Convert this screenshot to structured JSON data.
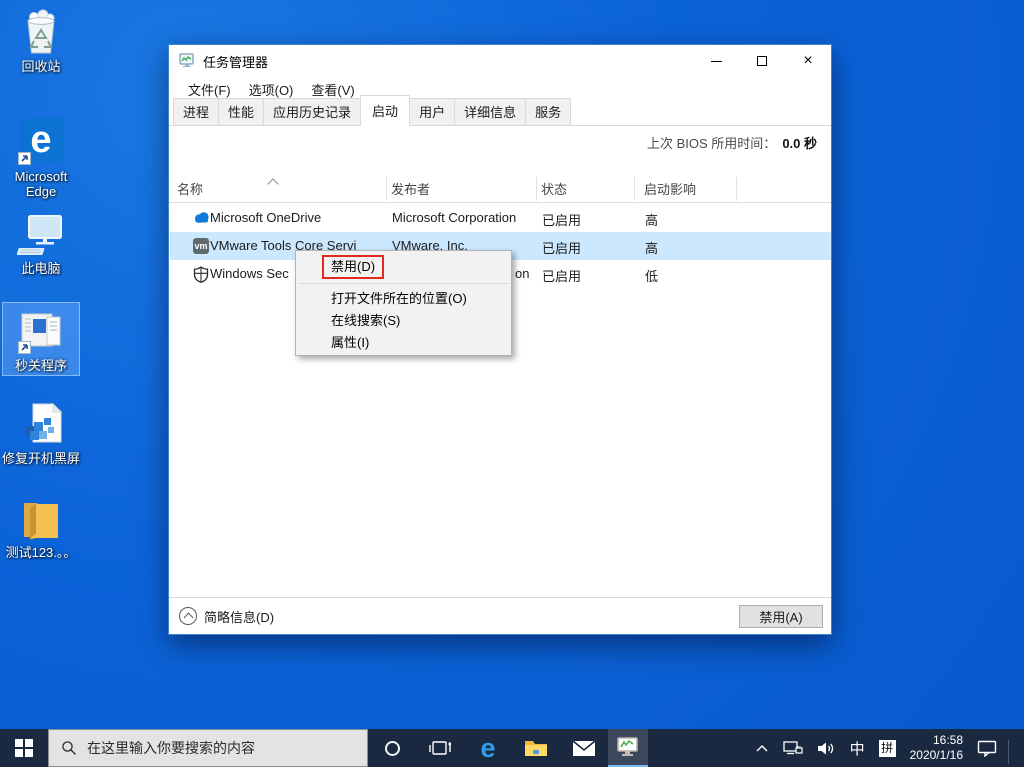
{
  "colors": {
    "desktop_blue": "#0b63d8",
    "taskbar_bg": "#1b2940",
    "selection_blue": "#cce8ff",
    "annotation_red": "#e02a1d",
    "edge_blue": "#0c72d4",
    "onedrive_blue": "#0f7bd8",
    "folder_yellow": "#f3c04f"
  },
  "desktop": {
    "icons": [
      {
        "label": "回收站",
        "icon": "recycle-bin"
      },
      {
        "label": "Microsoft Edge",
        "icon": "edge"
      },
      {
        "label": "此电脑",
        "icon": "this-pc"
      },
      {
        "label": "秒关程序",
        "icon": "app-window-shortcut",
        "selected": true
      },
      {
        "label": "修复开机黑屏",
        "icon": "registry-file"
      },
      {
        "label": "测试123.。。",
        "icon": "folder"
      }
    ]
  },
  "window": {
    "title": "任务管理器",
    "caption_buttons": {
      "minimize": "minimize",
      "maximize": "maximize",
      "close": "close"
    },
    "menu": [
      "文件(F)",
      "选项(O)",
      "查看(V)"
    ],
    "tabs": [
      {
        "label": "进程"
      },
      {
        "label": "性能"
      },
      {
        "label": "应用历史记录"
      },
      {
        "label": "启动",
        "active": true
      },
      {
        "label": "用户"
      },
      {
        "label": "详细信息"
      },
      {
        "label": "服务"
      }
    ],
    "bios_label": "上次 BIOS 所用时间：",
    "bios_value": "0.0 秒",
    "columns": [
      "名称",
      "发布者",
      "状态",
      "启动影响"
    ],
    "rows": [
      {
        "name": "Microsoft OneDrive",
        "publisher": "Microsoft Corporation",
        "status": "已启用",
        "impact": "高",
        "icon": "onedrive-cloud"
      },
      {
        "name": "VMware Tools Core Servi",
        "publisher": "VMware, Inc.",
        "status": "已启用",
        "impact": "高",
        "icon": "vmware",
        "icon_text": "vm",
        "selected": true
      },
      {
        "name": "Windows Sec",
        "publisher_visible": "on",
        "status": "已启用",
        "impact": "低",
        "icon": "security-shield"
      }
    ],
    "footer": {
      "details_label": "简略信息(D)",
      "action_button": "禁用(A)"
    }
  },
  "context_menu": {
    "items": [
      "禁用(D)",
      "打开文件所在的位置(O)",
      "在线搜索(S)",
      "属性(I)"
    ],
    "annotated_item": "禁用(D)"
  },
  "taskbar": {
    "search_placeholder": "在这里输入你要搜索的内容",
    "ime_indicator": "中",
    "ime_mode": "拼",
    "time": "16:58",
    "date": "2020/1/16"
  }
}
